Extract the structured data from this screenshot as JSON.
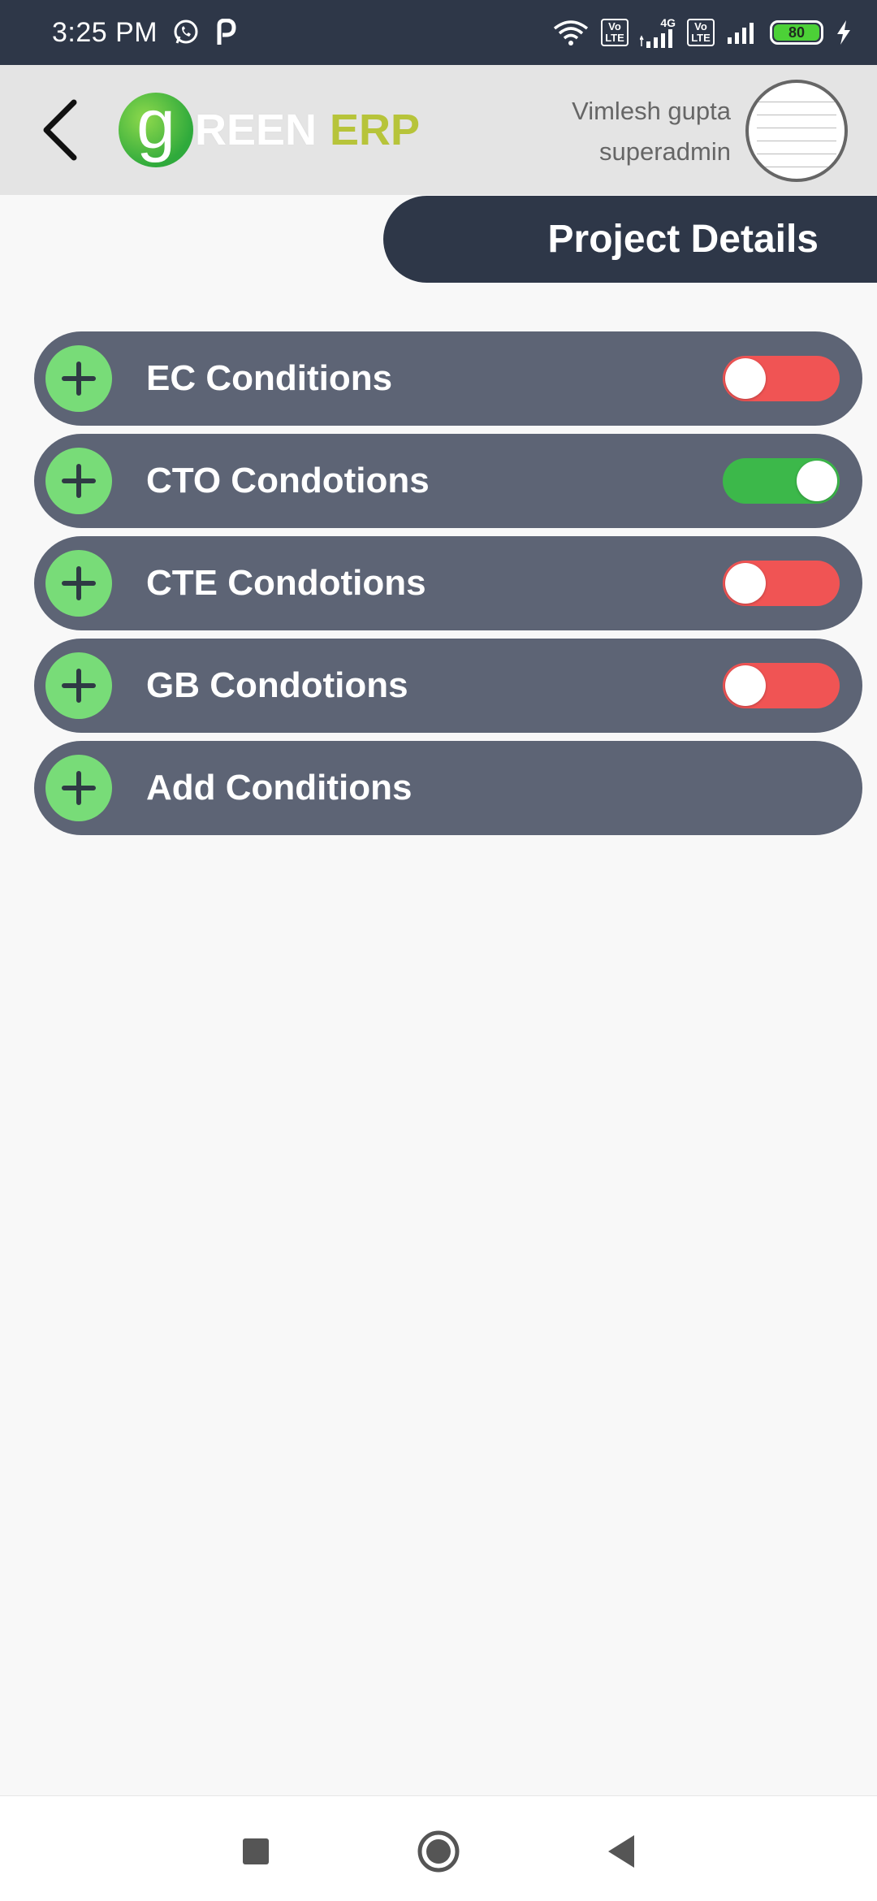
{
  "status_bar": {
    "time": "3:25 PM",
    "network_label": "4G",
    "volte_1": "Vo LTE",
    "volte_2": "Vo LTE",
    "battery_level": "80",
    "icons": [
      "whatsapp-icon",
      "paytm-icon",
      "wifi-icon",
      "signal-icon",
      "charging-icon"
    ]
  },
  "header": {
    "logo_g": "g",
    "logo_reen": "REEN",
    "logo_erp": "ERP",
    "user_name": "Vimlesh gupta",
    "user_role": "superadmin"
  },
  "page": {
    "title": "Project Details"
  },
  "conditions": [
    {
      "label": "EC Conditions",
      "toggle": "off"
    },
    {
      "label": "CTO Condotions",
      "toggle": "on"
    },
    {
      "label": "CTE Condotions",
      "toggle": "off"
    },
    {
      "label": "GB Condotions",
      "toggle": "off"
    },
    {
      "label": "Add Conditions",
      "toggle": null
    }
  ],
  "colors": {
    "dark": "#2e3748",
    "row_bg": "#5d6475",
    "plus_bg": "#78dc78",
    "toggle_off": "#f05454",
    "toggle_on": "#3cb84a",
    "brand_green": "#2faa3c",
    "brand_erp": "#b7c43a"
  }
}
